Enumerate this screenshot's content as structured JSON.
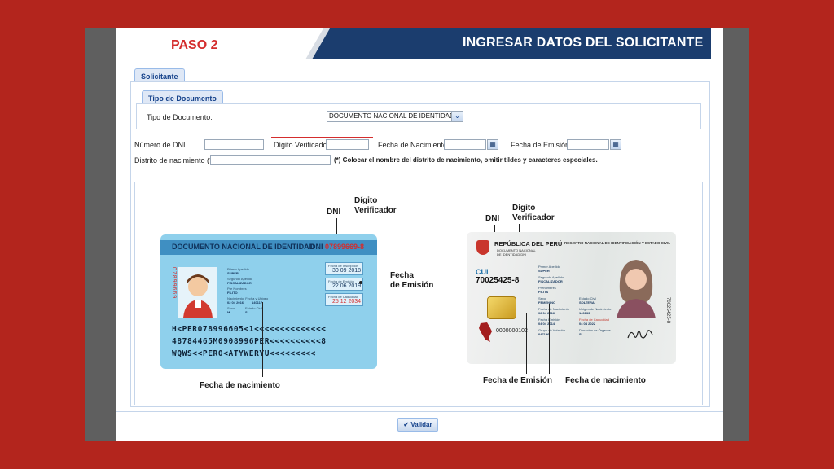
{
  "header": {
    "step": "PASO 2",
    "title": "INGRESAR DATOS DEL SOLICITANTE"
  },
  "tabs": {
    "solicitante": "Solicitante",
    "tipo_documento": "Tipo de Documento"
  },
  "form": {
    "tipo_documento_label": "Tipo de Documento:",
    "tipo_documento_value": "DOCUMENTO NACIONAL DE IDENTIDAD",
    "dni_label": "Número de DNI",
    "digito_label": "Dígito Verificador",
    "nacimiento_label": "Fecha de Nacimiento",
    "emision_label": "Fecha de Emisión",
    "distrito_label": "Distrito de nacimiento (*)",
    "distrito_note": "(*) Colocar el nombre del distrito de nacimiento, omitir tildes y caracteres especiales."
  },
  "card_old": {
    "title": "DOCUMENTO NACIONAL DE IDENTIDAD",
    "dni_prefix": "DNI",
    "dni_number": "07899669-8",
    "vertical_number": "07899669",
    "fields": {
      "primer_apellido_label": "Primer Apellido",
      "primer_apellido_value": "SUPER",
      "segundo_apellido_label": "Segundo Apellido",
      "segundo_apellido_value": "FISCALIZADOR",
      "pre_nombres_label": "Pre Nombres",
      "pre_nombres_value": "FILITO",
      "nacimiento_label": "Nacimiento: Fecha y Ubigeo",
      "nacimiento_value": "02 04 2016",
      "ubigeo_value": "140117",
      "sexo_label": "Sexo",
      "sexo_value": "M",
      "estado_civil_label": "Estado Civil",
      "estado_civil_value": "S"
    },
    "inscripcion_label": "Fecha de Inscripción",
    "inscripcion_value": "30 09 2018",
    "emision_label": "Fecha de Emisión",
    "emision_value": "22 06 2019",
    "caducidad_label": "Fecha de Caducidad",
    "caducidad_value": "25 12 2034",
    "mrz": [
      "H<PER078996605<1<<<<<<<<<<<<<<",
      "48784465M0908996PER<<<<<<<<<<8",
      "WQWS<<PER0<ATYWERYU<<<<<<<<<"
    ]
  },
  "card_new": {
    "republica": "REPÚBLICA DEL PERÚ",
    "doc_name_1": "DOCUMENTO NACIONAL",
    "doc_name_2": "DE IDENTIDAD DNI",
    "registro": "REGISTRO NACIONAL DE IDENTIFICACIÓN Y ESTADO CIVIL",
    "cui_label": "CUI",
    "cui_value": "70025425-8",
    "serial": "0000000102",
    "vertical_number": "70025425-8",
    "fields": {
      "primer_apellido_label": "Primer Apellido",
      "primer_apellido_value": "SUPER",
      "segundo_apellido_label": "Segundo Apellido",
      "segundo_apellido_value": "FISCALIZADOR",
      "prenombres_label": "Prenombres",
      "prenombres_value": "FILITA",
      "sexo_label": "Sexo",
      "sexo_value": "FEMENINO",
      "estado_civil_label": "Estado Civil",
      "estado_civil_value": "SOLTERA",
      "fecha_nacimiento_label": "Fecha de Nacimiento",
      "fecha_nacimiento_value": "02 04 2016",
      "ubigeo_label": "Ubigeo de Nacimiento",
      "ubigeo_value": "140133",
      "fecha_emision_label": "Fecha Emisión",
      "fecha_emision_value": "04 04 2014",
      "fecha_caducidad_label": "Fecha de Caducidad",
      "fecha_caducidad_value": "04 04 2022",
      "grupo_votacion_label": "Grupo de Votación",
      "grupo_votacion_value": "047196",
      "donacion_label": "Donación de Órganos",
      "donacion_value": "SI"
    }
  },
  "annotations": {
    "dni": "DNI",
    "digito_1": "Dígito",
    "digito_2": "Verificador",
    "fecha_emision_1": "Fecha",
    "fecha_emision_2": "de Emisión",
    "fecha_nacimiento": "Fecha de nacimiento",
    "fecha_emision_new": "Fecha de Emisión",
    "fecha_nacimiento_new": "Fecha de nacimiento"
  },
  "actions": {
    "validar": "Validar"
  },
  "colors": {
    "background": "#b3251d",
    "header_navy": "#1b3d6e",
    "step_red": "#d42d2d",
    "card_blue": "#8fd0ec"
  }
}
